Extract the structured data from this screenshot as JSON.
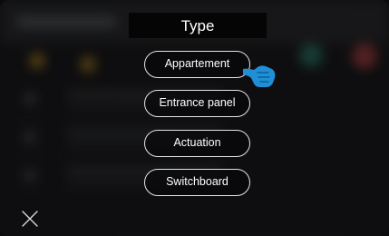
{
  "dialog": {
    "title": "Type",
    "options": [
      {
        "label": "Appartement",
        "selected": true
      },
      {
        "label": "Entrance panel",
        "selected": false
      },
      {
        "label": "Actuation",
        "selected": false
      },
      {
        "label": "Switchboard",
        "selected": false
      }
    ]
  },
  "icons": {
    "close": "close-icon",
    "pointer": "hand-pointer-icon"
  },
  "colors": {
    "option_border": "#e4e4e4",
    "pointer_hand": "#1f8fd6",
    "title_background": "#050505"
  }
}
